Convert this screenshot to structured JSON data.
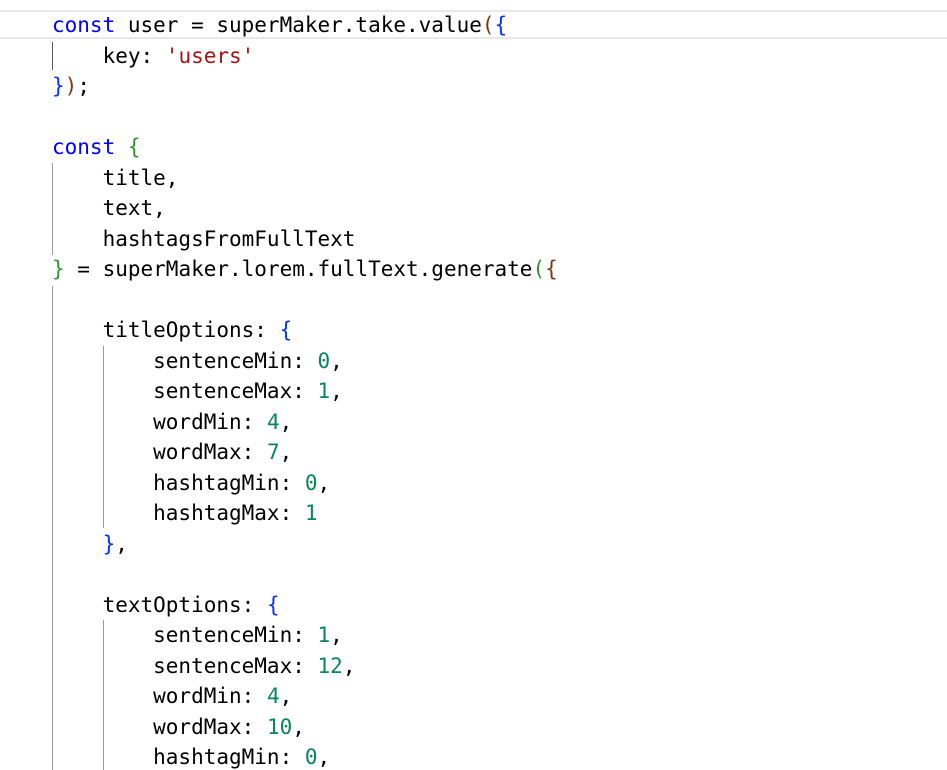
{
  "colors": {
    "keyword": "#0000ff",
    "identifier": "#000000",
    "string": "#a31515",
    "number": "#098658",
    "bracket_level1": "#0431fa",
    "bracket_level2": "#319331",
    "bracket_level3": "#7b3814",
    "background": "#ffffff",
    "current_line_border": "#e8e8e8"
  },
  "code_lines": [
    [
      {
        "t": "const",
        "k": "keyword"
      },
      {
        "t": " user = superMaker.take.value",
        "k": "identifier"
      },
      {
        "t": "(",
        "k": "bracket_level3"
      },
      {
        "t": "{",
        "k": "bracket_level1"
      }
    ],
    [
      {
        "t": "    key: ",
        "k": "identifier"
      },
      {
        "t": "'users'",
        "k": "string"
      }
    ],
    [
      {
        "t": "}",
        "k": "bracket_level1"
      },
      {
        "t": ")",
        "k": "bracket_level3"
      },
      {
        "t": ";",
        "k": "identifier"
      }
    ],
    [],
    [
      {
        "t": "const",
        "k": "keyword"
      },
      {
        "t": " ",
        "k": "identifier"
      },
      {
        "t": "{",
        "k": "bracket_level2"
      }
    ],
    [
      {
        "t": "    title,",
        "k": "identifier"
      }
    ],
    [
      {
        "t": "    text,",
        "k": "identifier"
      }
    ],
    [
      {
        "t": "    hashtagsFromFullText",
        "k": "identifier"
      }
    ],
    [
      {
        "t": "}",
        "k": "bracket_level2"
      },
      {
        "t": " = superMaker.lorem.fullText.generate",
        "k": "identifier"
      },
      {
        "t": "(",
        "k": "bracket_level2"
      },
      {
        "t": "{",
        "k": "bracket_level3"
      }
    ],
    [],
    [
      {
        "t": "    titleOptions: ",
        "k": "identifier"
      },
      {
        "t": "{",
        "k": "bracket_level1"
      }
    ],
    [
      {
        "t": "        sentenceMin: ",
        "k": "identifier"
      },
      {
        "t": "0",
        "k": "number"
      },
      {
        "t": ",",
        "k": "identifier"
      }
    ],
    [
      {
        "t": "        sentenceMax: ",
        "k": "identifier"
      },
      {
        "t": "1",
        "k": "number"
      },
      {
        "t": ",",
        "k": "identifier"
      }
    ],
    [
      {
        "t": "        wordMin: ",
        "k": "identifier"
      },
      {
        "t": "4",
        "k": "number"
      },
      {
        "t": ",",
        "k": "identifier"
      }
    ],
    [
      {
        "t": "        wordMax: ",
        "k": "identifier"
      },
      {
        "t": "7",
        "k": "number"
      },
      {
        "t": ",",
        "k": "identifier"
      }
    ],
    [
      {
        "t": "        hashtagMin: ",
        "k": "identifier"
      },
      {
        "t": "0",
        "k": "number"
      },
      {
        "t": ",",
        "k": "identifier"
      }
    ],
    [
      {
        "t": "        hashtagMax: ",
        "k": "identifier"
      },
      {
        "t": "1",
        "k": "number"
      }
    ],
    [
      {
        "t": "    ",
        "k": "identifier"
      },
      {
        "t": "}",
        "k": "bracket_level1"
      },
      {
        "t": ",",
        "k": "identifier"
      }
    ],
    [],
    [
      {
        "t": "    textOptions: ",
        "k": "identifier"
      },
      {
        "t": "{",
        "k": "bracket_level1"
      }
    ],
    [
      {
        "t": "        sentenceMin: ",
        "k": "identifier"
      },
      {
        "t": "1",
        "k": "number"
      },
      {
        "t": ",",
        "k": "identifier"
      }
    ],
    [
      {
        "t": "        sentenceMax: ",
        "k": "identifier"
      },
      {
        "t": "12",
        "k": "number"
      },
      {
        "t": ",",
        "k": "identifier"
      }
    ],
    [
      {
        "t": "        wordMin: ",
        "k": "identifier"
      },
      {
        "t": "4",
        "k": "number"
      },
      {
        "t": ",",
        "k": "identifier"
      }
    ],
    [
      {
        "t": "        wordMax: ",
        "k": "identifier"
      },
      {
        "t": "10",
        "k": "number"
      },
      {
        "t": ",",
        "k": "identifier"
      }
    ],
    [
      {
        "t": "        hashtagMin: ",
        "k": "identifier"
      },
      {
        "t": "0",
        "k": "number"
      },
      {
        "t": ",",
        "k": "identifier"
      }
    ]
  ]
}
